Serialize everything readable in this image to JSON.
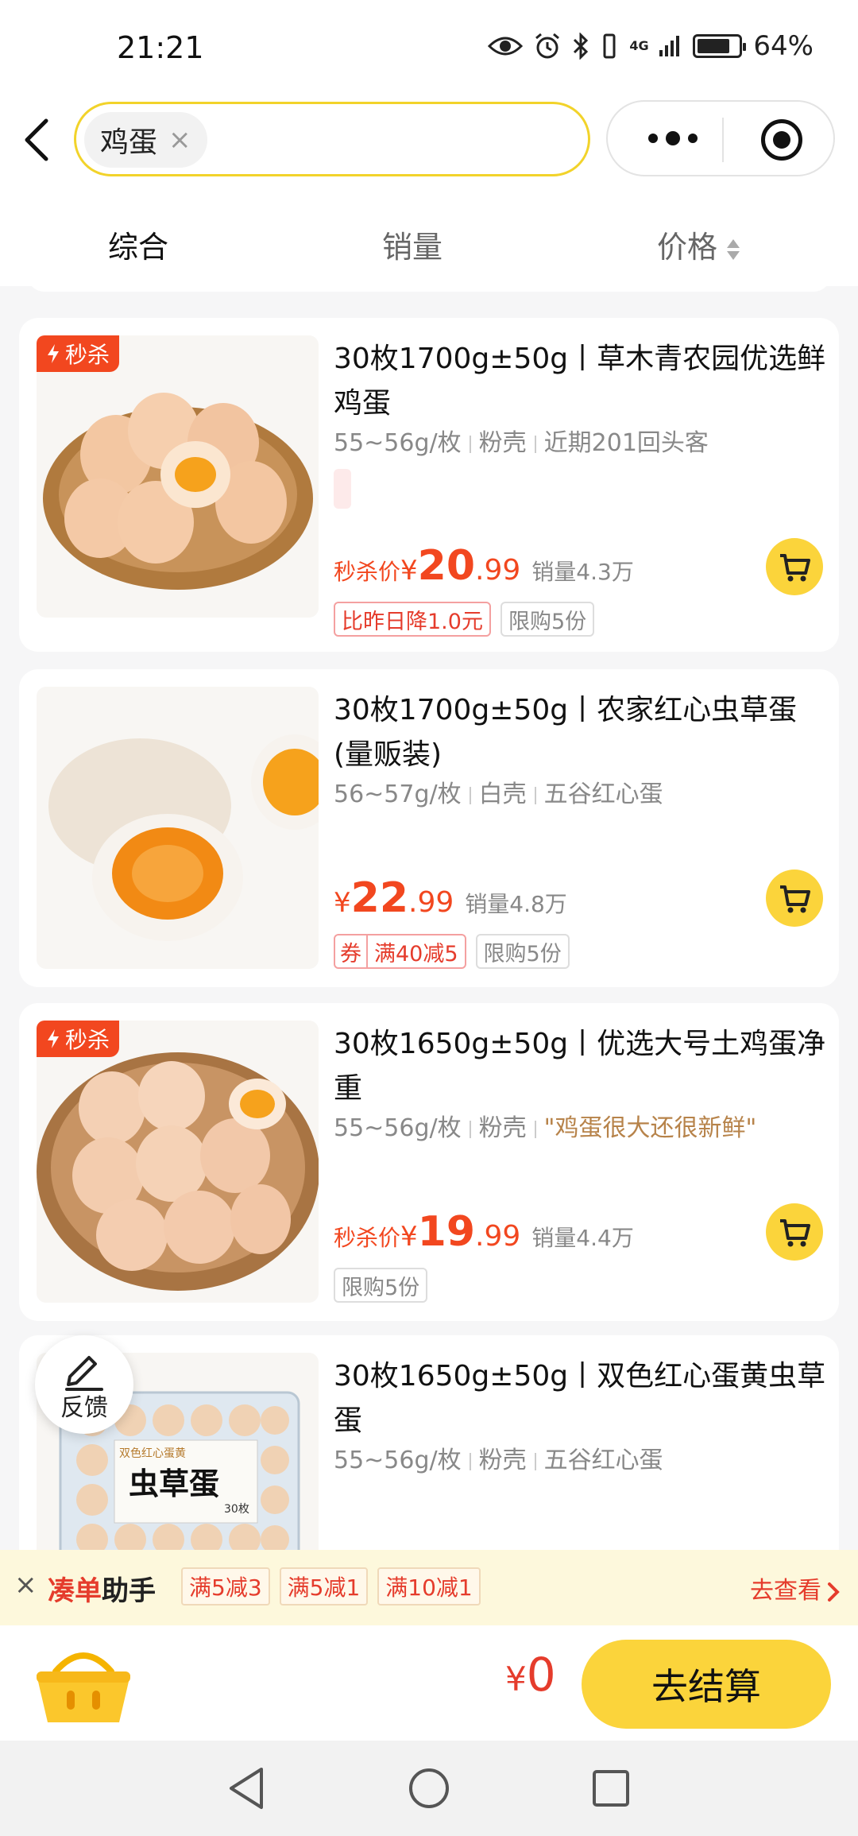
{
  "status_bar": {
    "time": "21:21",
    "battery": "64%",
    "network": "4G"
  },
  "search": {
    "keyword": "鸡蛋",
    "clear_symbol": "×"
  },
  "sort_tabs": [
    {
      "label": "综合",
      "active": true
    },
    {
      "label": "销量",
      "active": false
    },
    {
      "label": "价格",
      "active": false
    }
  ],
  "colors": {
    "accent_yellow": "#fbd43b",
    "price_red": "#f2471f",
    "search_border": "#f2d32a"
  },
  "products": [
    {
      "flash_badge": "秒杀",
      "title": "30枚1700g±50g丨草木青农园优选鲜鸡蛋",
      "spec": [
        "55~56g/枚",
        "粉壳",
        "近期201回头客"
      ],
      "price_label": "秒杀价",
      "currency": "¥",
      "price_int": "20",
      "price_dec": ".99",
      "sales": "销量4.3万",
      "tags": [
        "比昨日降1.0元",
        "限购5份"
      ]
    },
    {
      "title": "30枚1700g±50g丨农家红心虫草蛋(量贩装)",
      "spec": [
        "56~57g/枚",
        "白壳",
        "五谷红心蛋"
      ],
      "currency": "¥",
      "price_int": "22",
      "price_dec": ".99",
      "sales": "销量4.8万",
      "coupon_label": "券",
      "coupon_text": "满40减5",
      "tags": [
        "限购5份"
      ]
    },
    {
      "flash_badge": "秒杀",
      "title": "30枚1650g±50g丨优选大号土鸡蛋净重",
      "spec": [
        "55~56g/枚",
        "粉壳",
        "\"鸡蛋很大还很新鲜\""
      ],
      "price_label": "秒杀价",
      "currency": "¥",
      "price_int": "19",
      "price_dec": ".99",
      "sales": "销量4.4万",
      "tags": [
        "限购5份"
      ]
    },
    {
      "title": "30枚1650g±50g丨双色红心蛋黄虫草蛋",
      "spec": [
        "55~56g/枚",
        "粉壳",
        "五谷红心蛋"
      ],
      "box_label": "虫草蛋",
      "box_top_label": "双色红心蛋黄",
      "box_count": "30枚"
    }
  ],
  "feedback": {
    "label": "反馈"
  },
  "order_helper": {
    "close": "×",
    "title_red": "凑单",
    "title_black": "助手",
    "deals": [
      "满5减3",
      "满5减1",
      "满10减1"
    ],
    "view_link": "去查看"
  },
  "checkout": {
    "currency": "¥",
    "total": "0",
    "button_label": "去结算"
  }
}
